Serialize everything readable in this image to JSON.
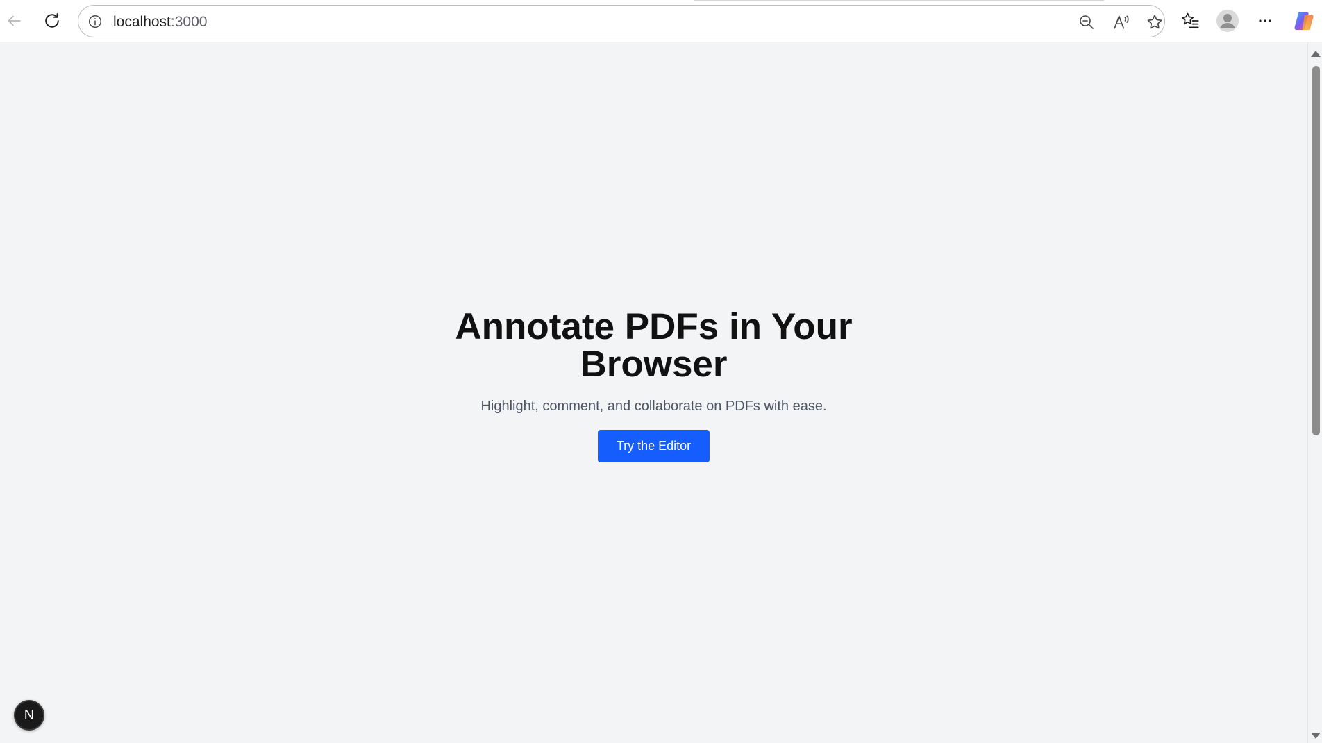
{
  "browser": {
    "address_host": "localhost",
    "address_port": ":3000",
    "icons": {
      "back": "back-arrow-icon",
      "reload": "reload-icon",
      "site_info": "info-icon",
      "zoom": "zoom-out-icon",
      "read_aloud": "read-aloud-icon",
      "favorite": "star-icon",
      "favorites_list": "favorites-icon",
      "profile": "profile-avatar-icon",
      "more": "more-icon",
      "copilot": "copilot-icon"
    }
  },
  "hero": {
    "title": "Annotate PDFs in Your Browser",
    "subtitle": "Highlight, comment, and collaborate on PDFs with ease.",
    "cta_label": "Try the Editor"
  },
  "dev_badge": {
    "label": "N"
  },
  "colors": {
    "page_bg": "#f3f4f6",
    "cta_bg": "#155dfc",
    "title": "#111111",
    "subtitle": "#4b5563"
  }
}
